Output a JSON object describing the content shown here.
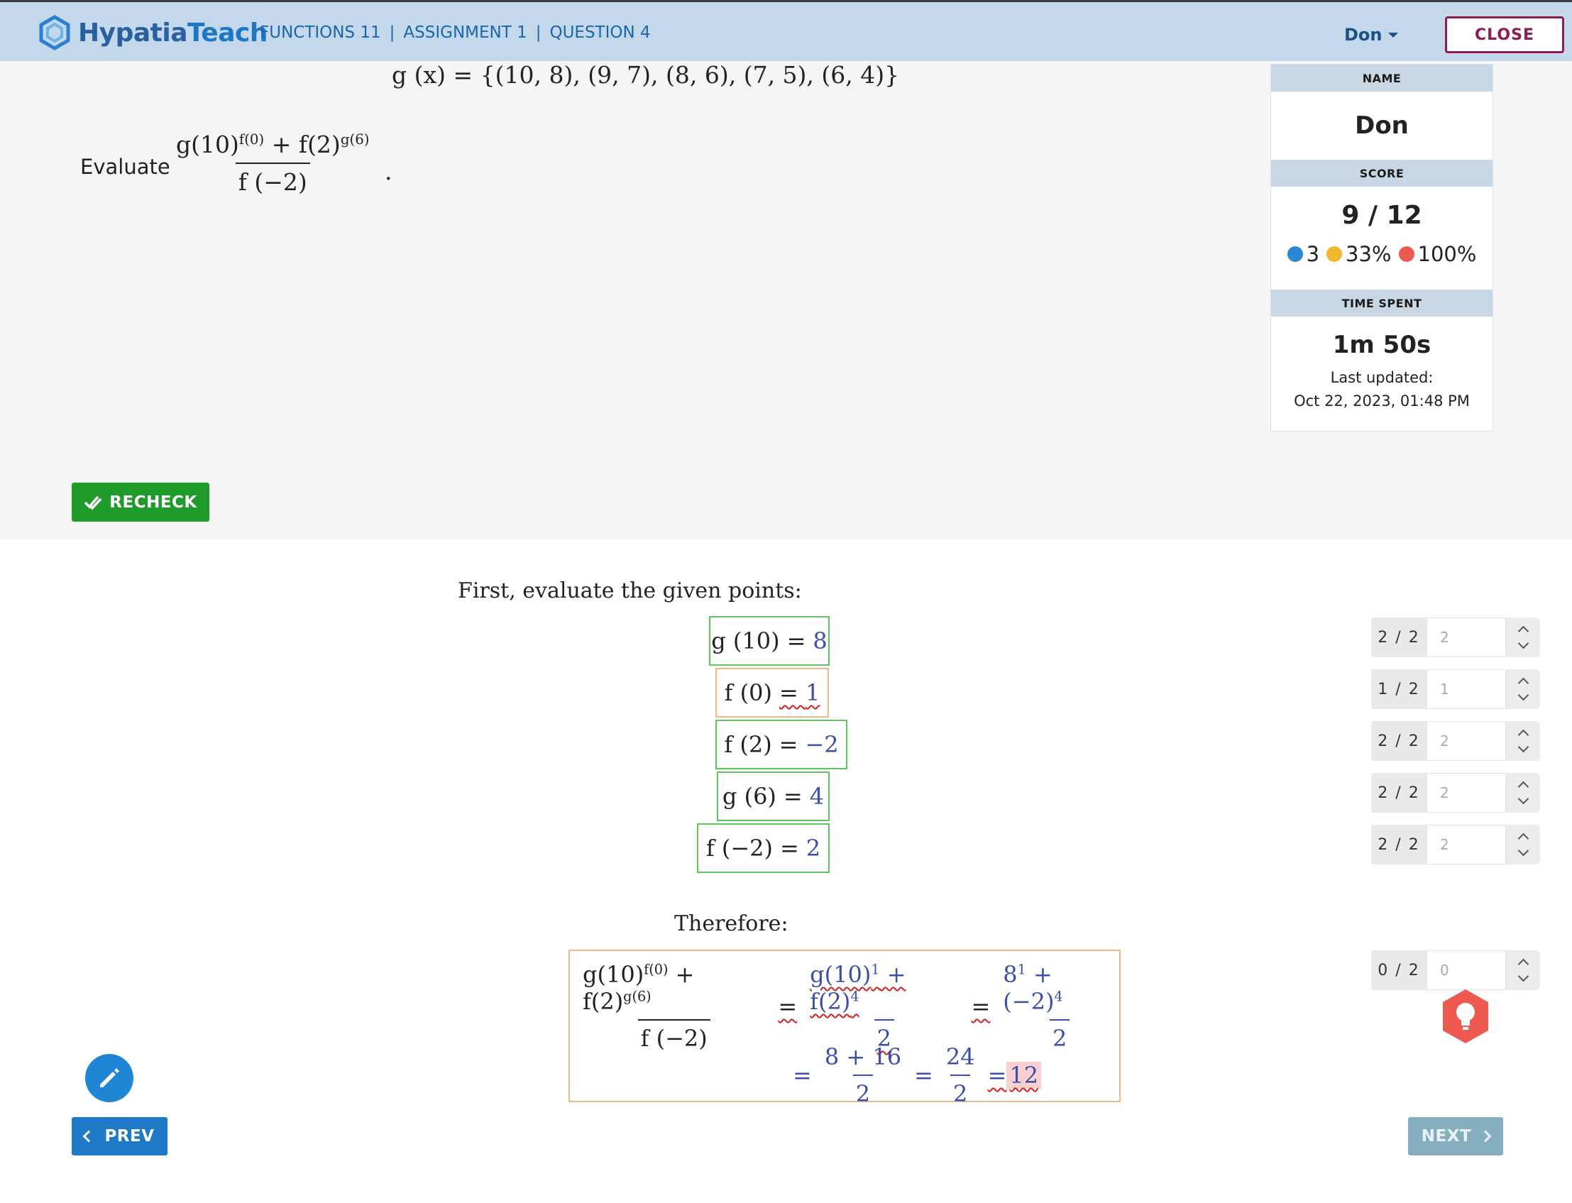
{
  "header": {
    "logo_part1": "Hypatia",
    "logo_part2": "Teach",
    "breadcrumbs": [
      "FUNCTIONS 11",
      "ASSIGNMENT 1",
      "QUESTION 4"
    ],
    "user": "Don",
    "close_label": "CLOSE"
  },
  "question": {
    "gx_set": "g (x) = {(10, 8), (9, 7), (8, 6), (7, 5), (6, 4)}",
    "evaluate_label": "Evaluate",
    "numerator_a": "g(10)",
    "numerator_a_exp": "f(0)",
    "numerator_plus": " + f(2)",
    "numerator_b_exp": "g(6)",
    "denominator": "f (−2)",
    "period": ".",
    "recheck_label": "RECHECK"
  },
  "panel": {
    "name_header": "NAME",
    "name": "Don",
    "score_header": "SCORE",
    "score": "9 / 12",
    "stat_blue": "3",
    "stat_yellow": "33%",
    "stat_red": "100%",
    "time_header": "TIME SPENT",
    "time": "1m 50s",
    "last_updated_label": "Last updated:",
    "last_updated": "Oct 22, 2023, 01:48 PM",
    "colors": {
      "blue": "#2a87d6",
      "yellow": "#f2b82e",
      "red": "#ef5a50"
    }
  },
  "solution": {
    "intro": "First, evaluate the given points:",
    "points": [
      {
        "lhs": "g (10)",
        "rhs": "8"
      },
      {
        "lhs": "f (0)",
        "rhs": "1"
      },
      {
        "lhs": "f (2)",
        "rhs": "−2"
      },
      {
        "lhs": "g (6)",
        "rhs": "4"
      },
      {
        "lhs": "f (−2)",
        "rhs": "2"
      }
    ],
    "therefore": "Therefore:",
    "step1_num_a": "g(10)",
    "step1_num_a_exp": "1",
    "step1_num_plus": " + f(2)",
    "step1_num_b_exp": "4",
    "step1_den": "2",
    "step2_num_a": "8",
    "step2_num_a_exp": "1",
    "step2_num_plus": " + (−2)",
    "step2_num_b_exp": "4",
    "step2_den": "2",
    "step3_num": "8 + 16",
    "step3_den": "2",
    "step4_num": "24",
    "step4_den": "2",
    "answer": "12"
  },
  "scores": [
    {
      "label": "2 / 2",
      "value": "2"
    },
    {
      "label": "1 / 2",
      "value": "1"
    },
    {
      "label": "2 / 2",
      "value": "2"
    },
    {
      "label": "2 / 2",
      "value": "2"
    },
    {
      "label": "2 / 2",
      "value": "2"
    },
    {
      "label": "0 / 2",
      "value": "0"
    }
  ],
  "nav": {
    "prev_label": "PREV",
    "next_label": "NEXT"
  }
}
